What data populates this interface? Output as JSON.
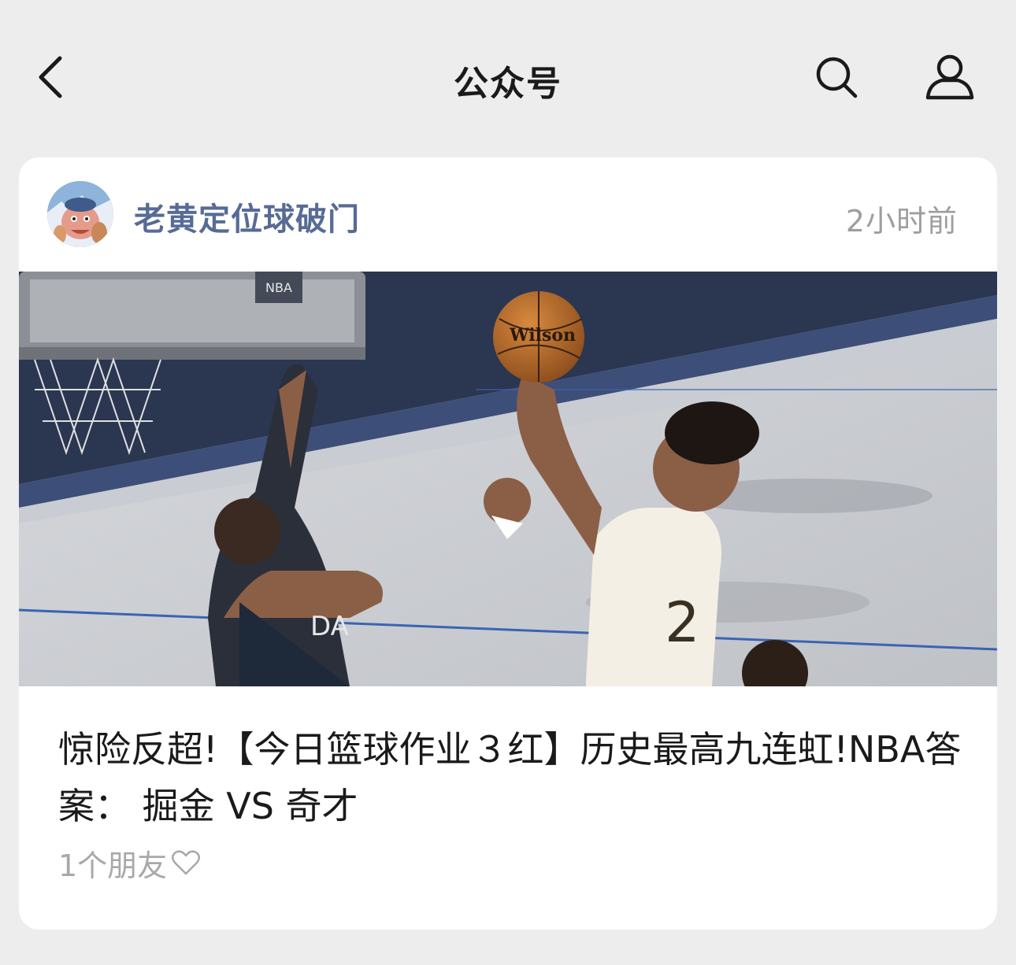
{
  "header": {
    "title": "公众号",
    "back_icon": "chevron-left-icon",
    "search_icon": "search-icon",
    "profile_icon": "person-icon"
  },
  "article": {
    "account_name": "老黄定位球破门",
    "time_ago": "2小时前",
    "headline": "惊险反超!【今日篮球作业３红】历史最高九连虹!NBA答案： 掘金 VS 奇才",
    "friends_label": "1个朋友",
    "like_icon": "heart-outline-icon"
  },
  "colors": {
    "background": "#ededed",
    "card": "#ffffff",
    "account_name": "#576b95",
    "muted": "#9e9e9e"
  }
}
